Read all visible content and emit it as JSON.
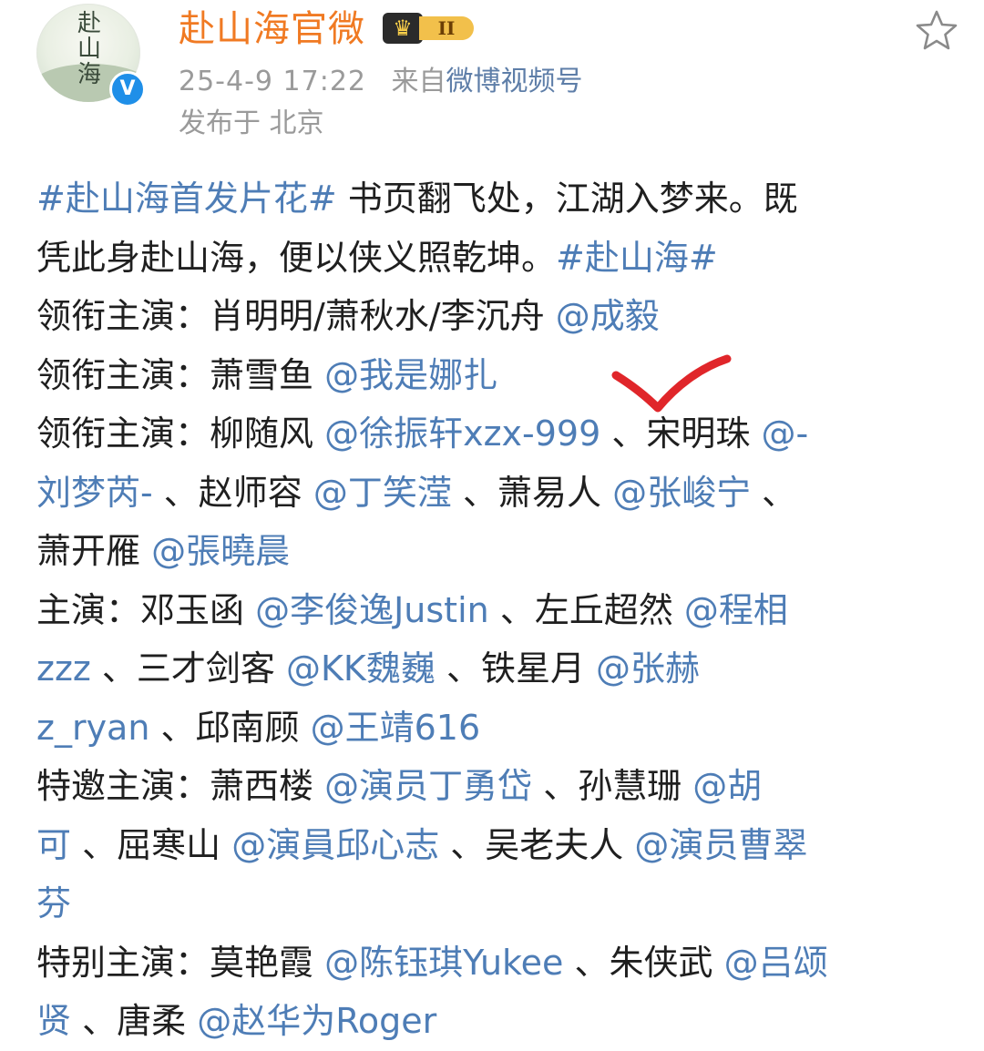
{
  "header": {
    "avatar_text": "赴山海",
    "verified_icon": "verified-v-icon",
    "username": "赴山海官微",
    "badge": {
      "icon": "crown-icon",
      "level": "II",
      "accent": "#f2c04b"
    },
    "favorite_icon": "star-outline-icon",
    "time": "25-4-9 17:22",
    "source_prefix": "来自",
    "source_name": "微博视频号",
    "location": "发布于 北京"
  },
  "colors": {
    "username": "#f07a23",
    "link": "#4e7db6",
    "meta": "#9a9a9a",
    "annotation": "#e0262a"
  },
  "annotation": {
    "icon": "red-checkmark-icon"
  },
  "post": {
    "lines": [
      [
        {
          "t": "#赴山海首发片花#",
          "link": true
        },
        {
          "t": " 书页翻飞处，江湖入梦来。既",
          "link": false
        }
      ],
      [
        {
          "t": "凭此身赴山海，便以侠义照乾坤。",
          "link": false
        },
        {
          "t": "#赴山海#",
          "link": true
        }
      ],
      [
        {
          "t": "领衔主演：肖明明/萧秋水/李沉舟 ",
          "link": false
        },
        {
          "t": "@成毅",
          "link": true
        }
      ],
      [
        {
          "t": "领衔主演：萧雪鱼 ",
          "link": false
        },
        {
          "t": "@我是娜扎",
          "link": true
        }
      ],
      [
        {
          "t": "领衔主演：柳随风 ",
          "link": false
        },
        {
          "t": "@徐振轩xzx-999",
          "link": true
        },
        {
          "t": " 、宋明珠 ",
          "link": false
        },
        {
          "t": "@-",
          "link": true
        }
      ],
      [
        {
          "t": "刘梦芮-",
          "link": true
        },
        {
          "t": " 、赵师容 ",
          "link": false
        },
        {
          "t": "@丁笑滢",
          "link": true
        },
        {
          "t": " 、萧易人 ",
          "link": false
        },
        {
          "t": "@张峻宁",
          "link": true
        },
        {
          "t": " 、",
          "link": false
        }
      ],
      [
        {
          "t": "萧开雁 ",
          "link": false
        },
        {
          "t": "@張曉晨",
          "link": true
        }
      ],
      [
        {
          "t": "主演：邓玉函 ",
          "link": false
        },
        {
          "t": "@李俊逸Justin",
          "link": true
        },
        {
          "t": " 、左丘超然 ",
          "link": false
        },
        {
          "t": "@程相",
          "link": true
        }
      ],
      [
        {
          "t": "zzz",
          "link": true
        },
        {
          "t": " 、三才剑客 ",
          "link": false
        },
        {
          "t": "@KK魏巍",
          "link": true
        },
        {
          "t": " 、铁星月 ",
          "link": false
        },
        {
          "t": "@张赫",
          "link": true
        }
      ],
      [
        {
          "t": "z_ryan",
          "link": true
        },
        {
          "t": " 、邱南顾 ",
          "link": false
        },
        {
          "t": "@王靖616",
          "link": true
        }
      ],
      [
        {
          "t": "特邀主演：萧西楼 ",
          "link": false
        },
        {
          "t": "@演员丁勇岱",
          "link": true
        },
        {
          "t": " 、孙慧珊 ",
          "link": false
        },
        {
          "t": "@胡",
          "link": true
        }
      ],
      [
        {
          "t": "可",
          "link": true
        },
        {
          "t": " 、屈寒山 ",
          "link": false
        },
        {
          "t": "@演員邱心志",
          "link": true
        },
        {
          "t": " 、吴老夫人 ",
          "link": false
        },
        {
          "t": "@演员曹翠",
          "link": true
        }
      ],
      [
        {
          "t": "芬",
          "link": true
        }
      ],
      [
        {
          "t": "特别主演：莫艳霞 ",
          "link": false
        },
        {
          "t": "@陈钰琪Yukee",
          "link": true
        },
        {
          "t": " 、朱侠武 ",
          "link": false
        },
        {
          "t": "@吕颂",
          "link": true
        }
      ],
      [
        {
          "t": "贤",
          "link": true
        },
        {
          "t": " 、唐柔 ",
          "link": false
        },
        {
          "t": "@赵华为Roger",
          "link": true
        }
      ]
    ]
  }
}
